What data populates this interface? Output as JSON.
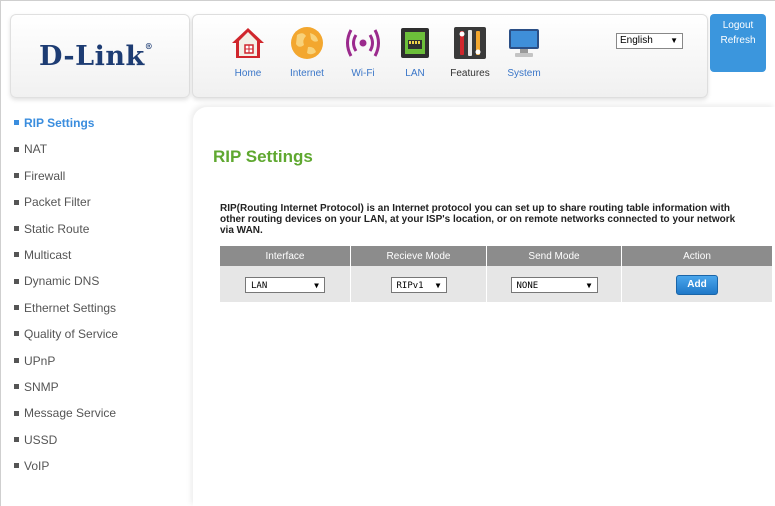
{
  "brand": {
    "name": "D-Link"
  },
  "nav": {
    "items": [
      {
        "label": "Home",
        "icon": "home-icon"
      },
      {
        "label": "Internet",
        "icon": "globe-icon"
      },
      {
        "label": "Wi-Fi",
        "icon": "wifi-icon"
      },
      {
        "label": "LAN",
        "icon": "lan-port-icon"
      },
      {
        "label": "Features",
        "icon": "features-tools-icon"
      },
      {
        "label": "System",
        "icon": "computer-monitor-icon"
      }
    ]
  },
  "language": {
    "selected": "English"
  },
  "account": {
    "logout": "Logout",
    "refresh": "Refresh"
  },
  "sidebar": {
    "items": [
      {
        "label": "RIP Settings",
        "active": true
      },
      {
        "label": "NAT"
      },
      {
        "label": "Firewall"
      },
      {
        "label": "Packet Filter"
      },
      {
        "label": "Static Route"
      },
      {
        "label": "Multicast"
      },
      {
        "label": "Dynamic DNS"
      },
      {
        "label": "Ethernet Settings"
      },
      {
        "label": "Quality of Service"
      },
      {
        "label": "UPnP"
      },
      {
        "label": "SNMP"
      },
      {
        "label": "Message Service"
      },
      {
        "label": "USSD"
      },
      {
        "label": "VoIP"
      }
    ]
  },
  "main": {
    "title": "RIP Settings",
    "description": "RIP(Routing Internet Protocol) is an Internet protocol you can set up to share routing table information with other routing devices on your LAN, at your ISP's location, or on remote networks connected to your network via WAN.",
    "table": {
      "headers": [
        "Interface",
        "Recieve Mode",
        "Send Mode",
        "Action"
      ],
      "row": {
        "interface": "LAN",
        "receive_mode": "RIPv1",
        "send_mode": "NONE",
        "action": "Add"
      }
    }
  },
  "colors": {
    "accent_blue": "#3a8dde",
    "title_green": "#5fa830",
    "header_gray": "#8c8c8c",
    "logo_navy": "#1d3c73"
  }
}
